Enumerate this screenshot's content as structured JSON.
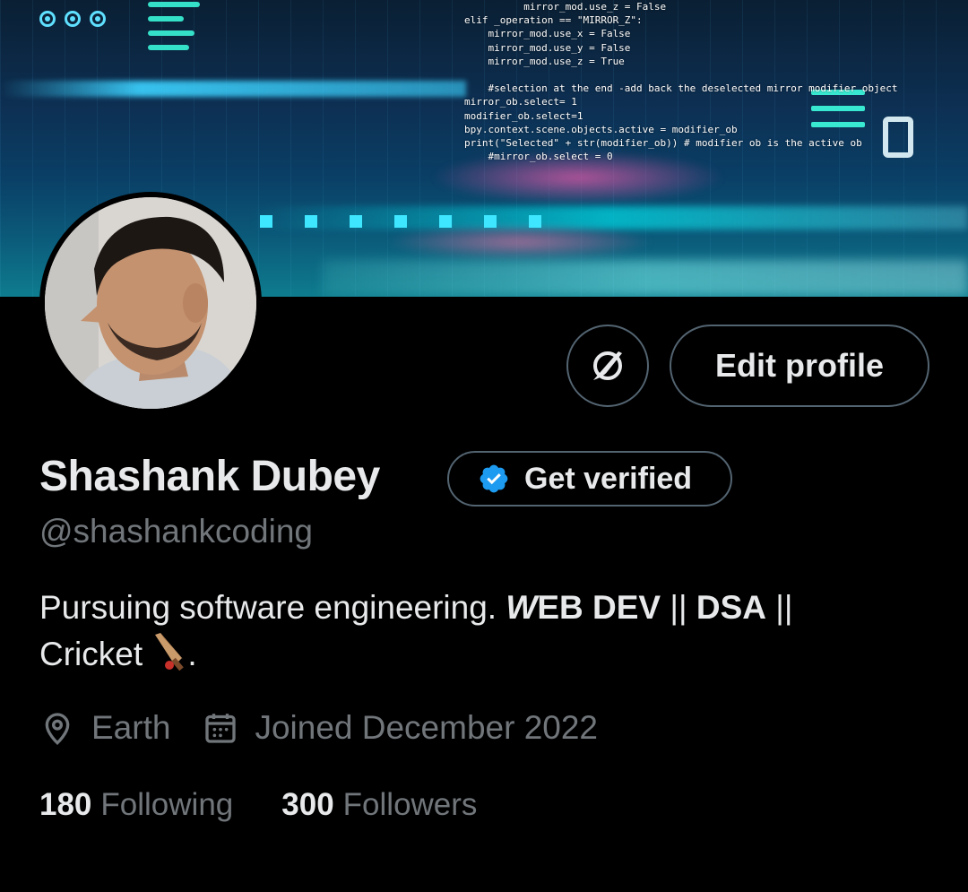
{
  "profile": {
    "name": "Shashank Dubey",
    "handle": "@shashankcoding",
    "bio_prefix": "Pursuing software engineering. ",
    "bio_bold_w": "W",
    "bio_bold_rest": "EB DEV",
    "bio_sep1": " || ",
    "bio_bold_dsa": "DSA",
    "bio_sep2": " ||",
    "bio_line2": "Cricket ",
    "bio_suffix": ".",
    "location": "Earth",
    "joined": "Joined December 2022"
  },
  "actions": {
    "edit_profile_label": "Edit profile",
    "get_verified_label": "Get verified"
  },
  "stats": {
    "following_count": "180",
    "following_label": "Following",
    "followers_count": "300",
    "followers_label": "Followers"
  },
  "banner": {
    "code_lines": [
      "          mirror_mod.use_z = False",
      "elif _operation == \"MIRROR_Z\":",
      "    mirror_mod.use_x = False",
      "    mirror_mod.use_y = False",
      "    mirror_mod.use_z = True",
      "",
      "    #selection at the end -add back the deselected mirror modifier object",
      "mirror_ob.select= 1",
      "modifier_ob.select=1",
      "bpy.context.scene.objects.active = modifier_ob",
      "print(\"Selected\" + str(modifier_ob)) # modifier ob is the active ob",
      "    #mirror_ob.select = 0"
    ]
  },
  "icons": {
    "more_icon": "circle-slash-icon",
    "verified_icon": "verified-badge-icon",
    "location_icon": "location-pin-icon",
    "calendar_icon": "calendar-icon",
    "cricket_icon": "cricket-bat-emoji"
  },
  "colors": {
    "background": "#000000",
    "text_primary": "#e7e9ea",
    "text_secondary": "#71767b",
    "border": "#536471",
    "verified_blue": "#1d9bf0"
  }
}
